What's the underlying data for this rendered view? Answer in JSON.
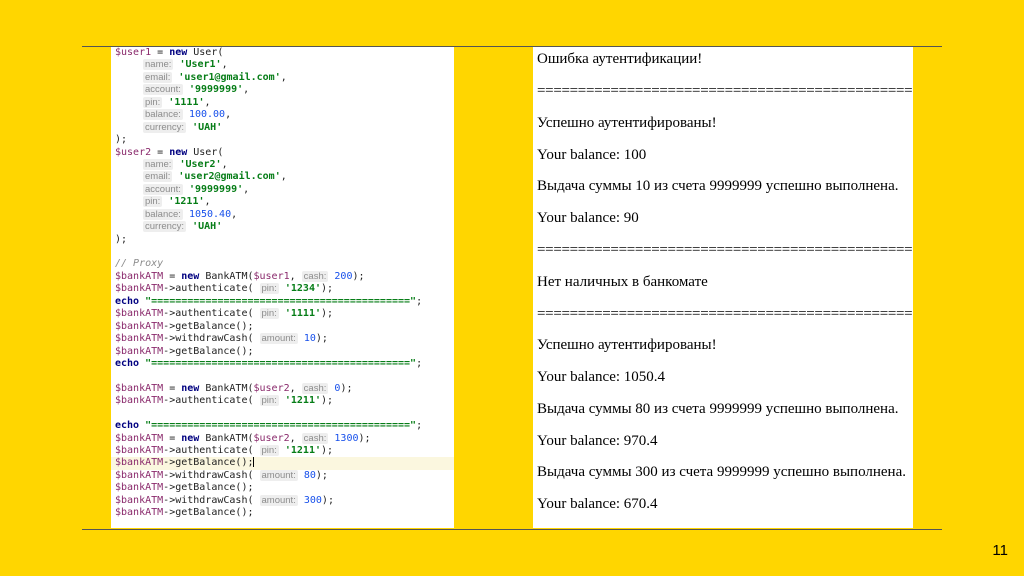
{
  "code_lines": [
    "$user1 = new User(",
    "name: 'User1',",
    "email: 'user1@gmail.com',",
    "account: '9999999',",
    "pin: '1111',",
    "balance: 100.00,",
    "currency: 'UAH'",
    ");",
    "$user2 = new User(",
    "name: 'User2',",
    "email: 'user2@gmail.com',",
    "account: '9999999',",
    "pin: '1211',",
    "balance: 1050.40,",
    "currency: 'UAH'",
    ");",
    "",
    "// Proxy",
    "$bankATM = new BankATM($user1, cash: 200);",
    "$bankATM->authenticate( pin: '1234');",
    "echo \"==========================================\";",
    "$bankATM->authenticate( pin: '1111');",
    "$bankATM->getBalance();",
    "$bankATM->withdrawCash( amount: 10);",
    "$bankATM->getBalance();",
    "echo \"==========================================\";",
    "",
    "$bankATM = new BankATM($user2, cash: 0);",
    "$bankATM->authenticate( pin: '1211');",
    "",
    "echo \"==========================================\";",
    "$bankATM = new BankATM($user2, cash: 1300);",
    "$bankATM->authenticate( pin: '1211');",
    "$bankATM->getBalance();",
    "$bankATM->withdrawCash( amount: 80);",
    "$bankATM->getBalance();",
    "$bankATM->withdrawCash( amount: 300);",
    "$bankATM->getBalance();"
  ],
  "output_lines": [
    "Ошибка аутентификации!",
    "================================================",
    "Успешно аутентифированы!",
    "Your balance: 100",
    "Выдача суммы 10 из счета 9999999 успешно выполнена.",
    "Your balance: 90",
    "================================================",
    "Нет наличных в банкомате",
    "================================================",
    "Успешно аутентифированы!",
    "Your balance: 1050.4",
    "Выдача суммы 80 из счета 9999999 успешно выполнена.",
    "Your balance: 970.4",
    "Выдача суммы 300 из счета 9999999 успешно выполнена.",
    "Your balance: 670.4"
  ],
  "page_number": "11"
}
